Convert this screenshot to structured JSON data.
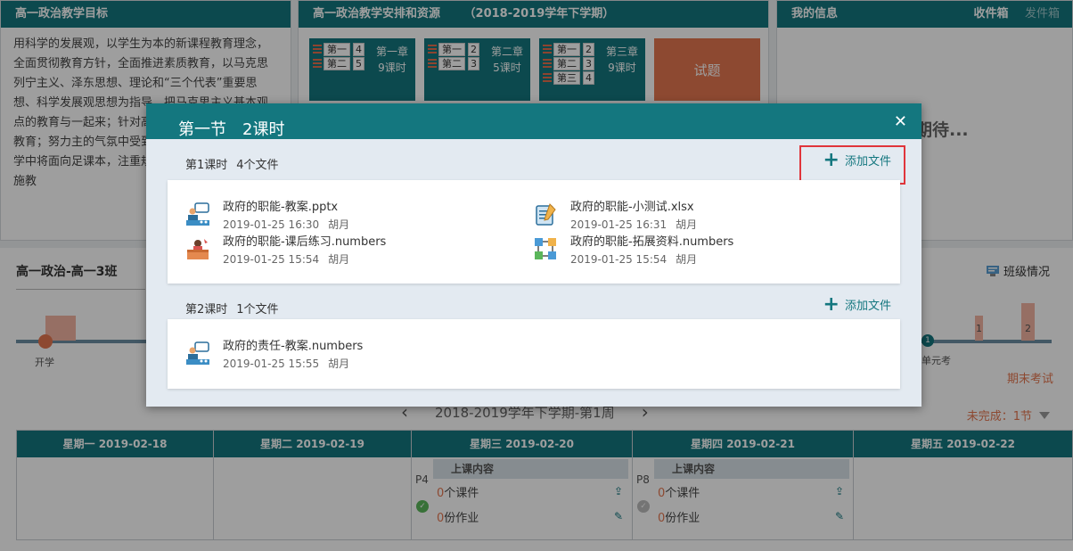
{
  "goal": {
    "title": "高一政治教学目标",
    "text": "用科学的发展观，以学生为本的新课程教育理念，全面贯彻教育方针，全面推进素质教育，以马克思列宁主义、泽东思想、理论和“三个代表”重要思想、科学发展观思想为指导，把马克思主义基本观点的教育与一起来；针对高中生成长诱地进行思想教育；努力主的气氛中受到知识、启面的熏陶。教学中将面向足课本，注重规范；强化重基础，因材施教"
  },
  "plan": {
    "title": "高一政治教学安排和资源",
    "term": "（2018-2019学年下学期）",
    "chapters": [
      {
        "rows": [
          {
            "label": "第一",
            "num": "4"
          },
          {
            "label": "第二",
            "num": "5"
          }
        ],
        "title": "第一章",
        "hours": "9课时"
      },
      {
        "rows": [
          {
            "label": "第一",
            "num": "2"
          },
          {
            "label": "第二",
            "num": "3"
          }
        ],
        "title": "第二章",
        "hours": "5课时"
      },
      {
        "rows": [
          {
            "label": "第一",
            "num": "2"
          },
          {
            "label": "第二",
            "num": "3"
          },
          {
            "label": "第三",
            "num": "4"
          }
        ],
        "title": "第三章",
        "hours": "9课时"
      }
    ],
    "exam_tile": "试题"
  },
  "info": {
    "title": "我的信息",
    "tab_inbox": "收件箱",
    "tab_sent": "发件箱",
    "placeholder": "期待..."
  },
  "class": {
    "title": "高一政治-高一3班",
    "status_label": "班级情况",
    "start_label": "开学",
    "unit_exam_label": "单元考",
    "unit_num": "1",
    "bar_labels": [
      "1",
      "2"
    ],
    "final_exam": "期末考试",
    "incomplete": "未完成：1节",
    "week_nav": "2018-2019学年下学期-第1周",
    "week_prev": "‹",
    "week_next": "›"
  },
  "week": [
    {
      "head": "星期一 2019-02-18"
    },
    {
      "head": "星期二 2019-02-19"
    },
    {
      "head": "星期三 2019-02-20",
      "period": "P4",
      "lesson_head": "上课内容",
      "courseware_count": "0",
      "courseware_label": "个课件",
      "homework_count": "0",
      "homework_label": "份作业"
    },
    {
      "head": "星期四 2019-02-21",
      "period": "P8",
      "lesson_head": "上课内容",
      "courseware_count": "0",
      "courseware_label": "个课件",
      "homework_count": "0",
      "homework_label": "份作业"
    },
    {
      "head": "星期五 2019-02-22"
    }
  ],
  "modal": {
    "title": "第一节　2课时",
    "close": "✕",
    "sections": [
      {
        "label": "第1课时",
        "count": "4个文件",
        "add_label": "添加文件",
        "files": [
          {
            "name": "政府的职能-教案.pptx",
            "date": "2019-01-25 16:30",
            "author": "胡月",
            "icon": "lecture-icon"
          },
          {
            "name": "政府的职能-小测试.xlsx",
            "date": "2019-01-25 16:31",
            "author": "胡月",
            "icon": "quiz-icon"
          },
          {
            "name": "政府的职能-课后练习.numbers",
            "date": "2019-01-25 15:54",
            "author": "胡月",
            "icon": "exercise-icon"
          },
          {
            "name": "政府的职能-拓展资料.numbers",
            "date": "2019-01-25 15:54",
            "author": "胡月",
            "icon": "extension-icon"
          }
        ]
      },
      {
        "label": "第2课时",
        "count": "1个文件",
        "add_label": "添加文件",
        "files": [
          {
            "name": "政府的责任-教案.numbers",
            "date": "2019-01-25 15:55",
            "author": "胡月",
            "icon": "lecture-icon"
          }
        ]
      }
    ]
  },
  "colors": {
    "teal": "#14777f",
    "orange": "#e4764f",
    "highlight": "#e0353b"
  }
}
